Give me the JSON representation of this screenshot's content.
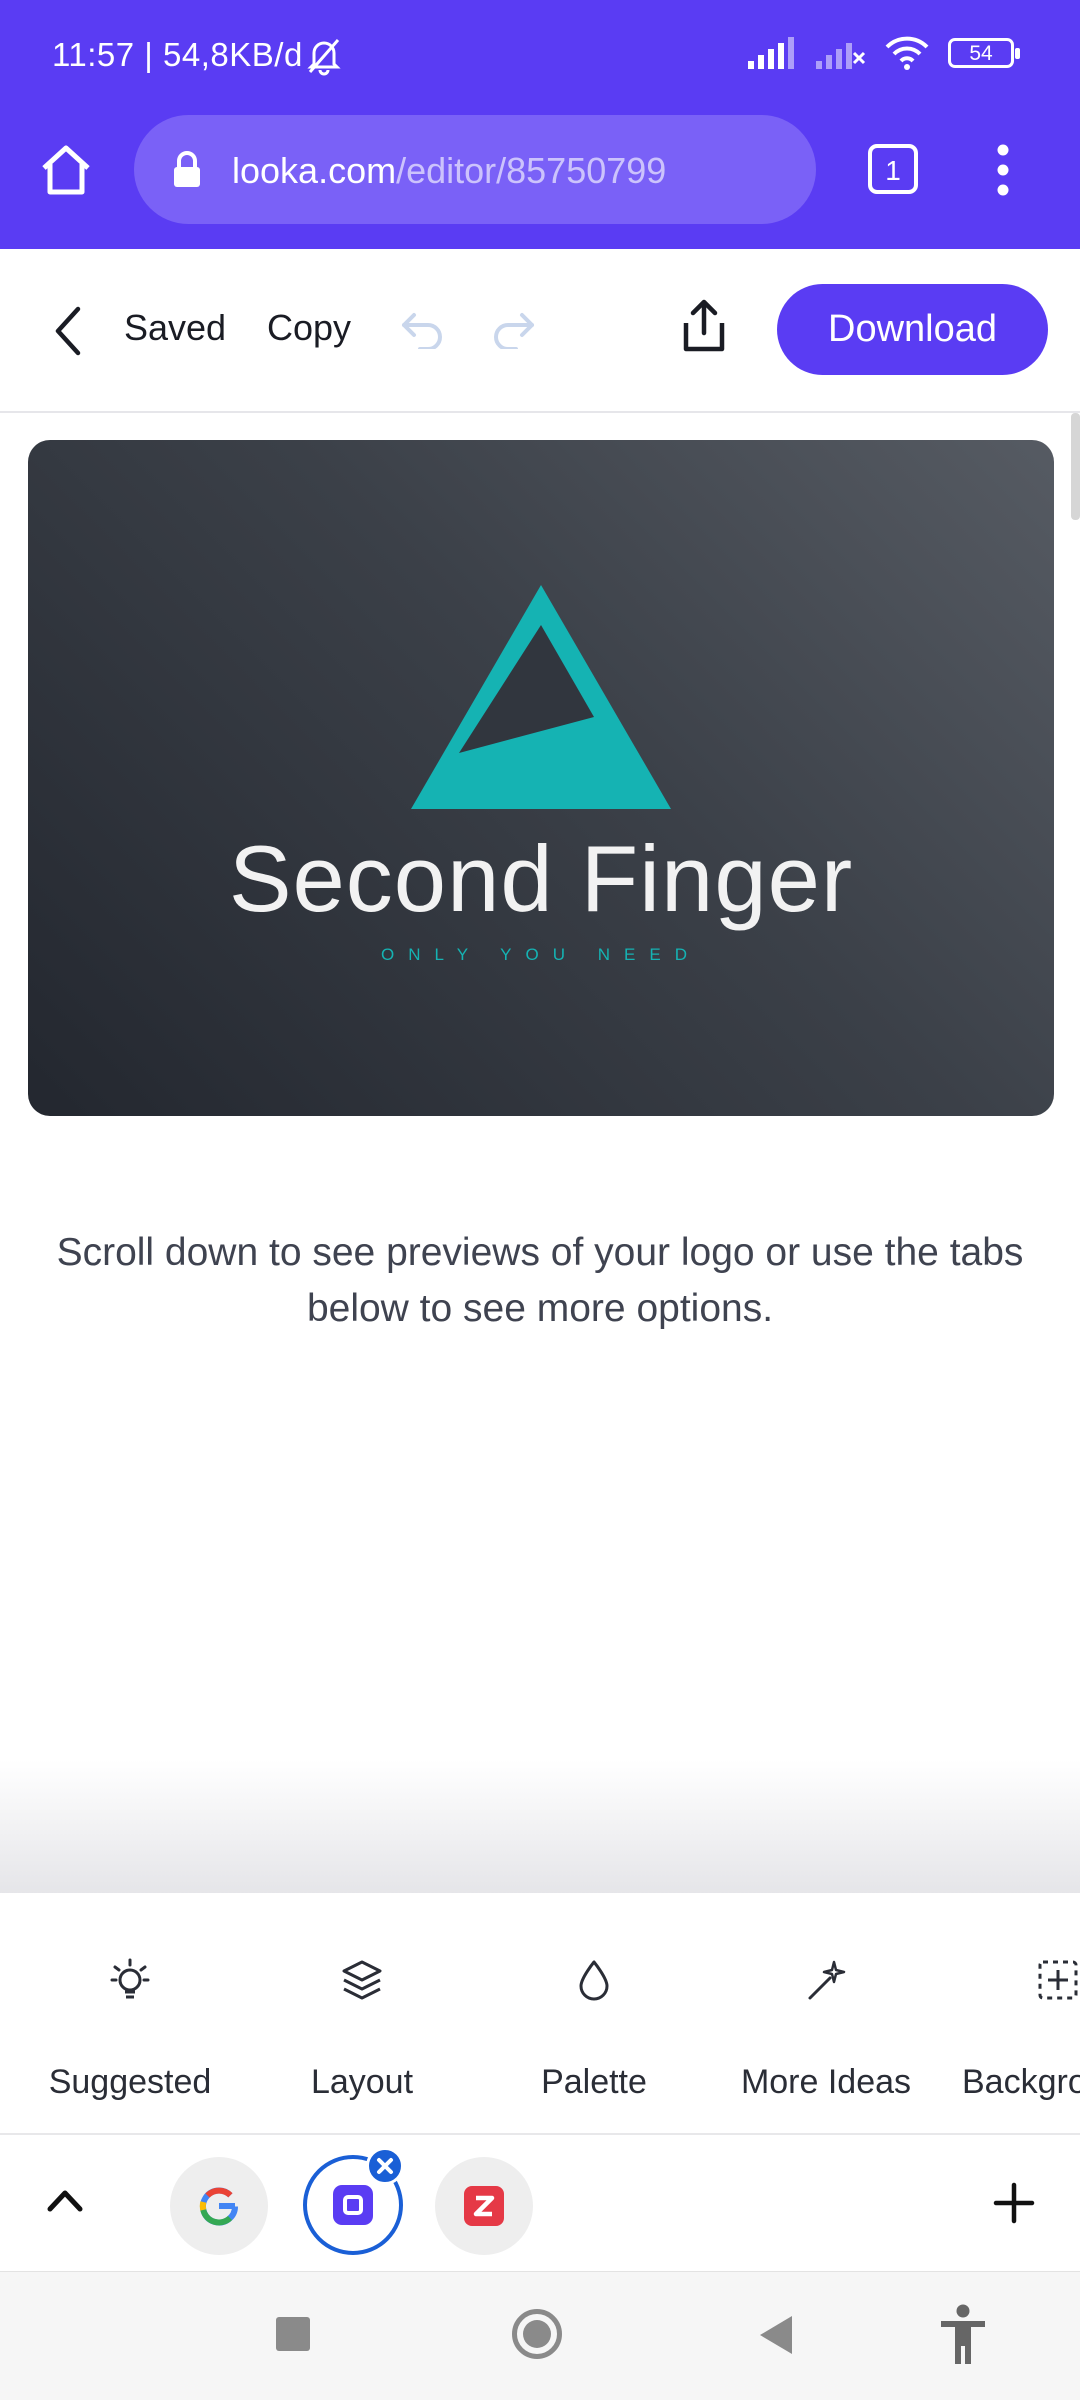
{
  "status_bar": {
    "time": "11:57 | 54,8KB/d",
    "battery": "54"
  },
  "browser": {
    "url_domain": "looka.com",
    "url_path": "/editor/85750799",
    "tab_count": "1"
  },
  "toolbar": {
    "saved_label": "Saved",
    "copy_label": "Copy",
    "download_label": "Download"
  },
  "logo": {
    "name": "Second Finger",
    "tagline": "ONLY YOU NEED",
    "accent_color": "#15b3b3",
    "background": "#2b2f37"
  },
  "hint": "Scroll down to see previews of your logo or use the tabs below to see more options.",
  "tabs": [
    {
      "label": "Suggested",
      "icon": "lightbulb-icon"
    },
    {
      "label": "Layout",
      "icon": "layers-icon"
    },
    {
      "label": "Palette",
      "icon": "drop-icon"
    },
    {
      "label": "More Ideas",
      "icon": "magic-wand-icon"
    },
    {
      "label": "Backgro",
      "icon": "background-grid-icon"
    }
  ],
  "colors": {
    "brand": "#5a3cf3",
    "tab_letter_z": "#e53946"
  }
}
